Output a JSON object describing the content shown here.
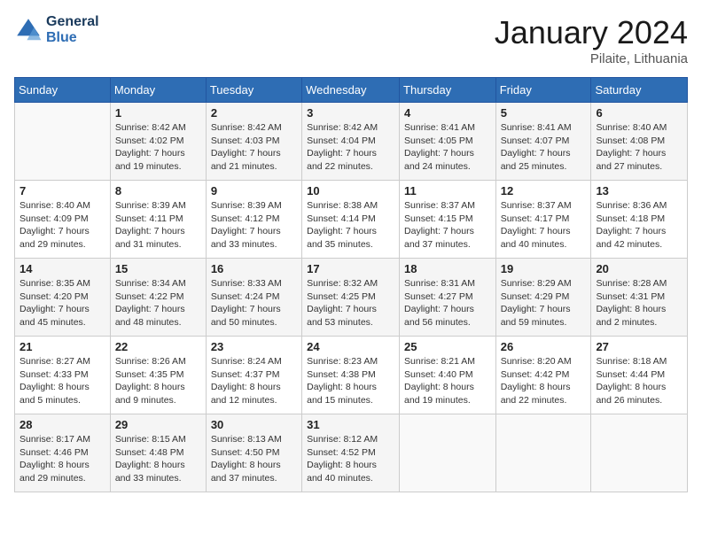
{
  "header": {
    "logo_line1": "General",
    "logo_line2": "Blue",
    "month": "January 2024",
    "location": "Pilaite, Lithuania"
  },
  "weekdays": [
    "Sunday",
    "Monday",
    "Tuesday",
    "Wednesday",
    "Thursday",
    "Friday",
    "Saturday"
  ],
  "weeks": [
    [
      {
        "day": "",
        "sunrise": "",
        "sunset": "",
        "daylight": ""
      },
      {
        "day": "1",
        "sunrise": "8:42 AM",
        "sunset": "4:02 PM",
        "daylight": "7 hours and 19 minutes."
      },
      {
        "day": "2",
        "sunrise": "8:42 AM",
        "sunset": "4:03 PM",
        "daylight": "7 hours and 21 minutes."
      },
      {
        "day": "3",
        "sunrise": "8:42 AM",
        "sunset": "4:04 PM",
        "daylight": "7 hours and 22 minutes."
      },
      {
        "day": "4",
        "sunrise": "8:41 AM",
        "sunset": "4:05 PM",
        "daylight": "7 hours and 24 minutes."
      },
      {
        "day": "5",
        "sunrise": "8:41 AM",
        "sunset": "4:07 PM",
        "daylight": "7 hours and 25 minutes."
      },
      {
        "day": "6",
        "sunrise": "8:40 AM",
        "sunset": "4:08 PM",
        "daylight": "7 hours and 27 minutes."
      }
    ],
    [
      {
        "day": "7",
        "sunrise": "8:40 AM",
        "sunset": "4:09 PM",
        "daylight": "7 hours and 29 minutes."
      },
      {
        "day": "8",
        "sunrise": "8:39 AM",
        "sunset": "4:11 PM",
        "daylight": "7 hours and 31 minutes."
      },
      {
        "day": "9",
        "sunrise": "8:39 AM",
        "sunset": "4:12 PM",
        "daylight": "7 hours and 33 minutes."
      },
      {
        "day": "10",
        "sunrise": "8:38 AM",
        "sunset": "4:14 PM",
        "daylight": "7 hours and 35 minutes."
      },
      {
        "day": "11",
        "sunrise": "8:37 AM",
        "sunset": "4:15 PM",
        "daylight": "7 hours and 37 minutes."
      },
      {
        "day": "12",
        "sunrise": "8:37 AM",
        "sunset": "4:17 PM",
        "daylight": "7 hours and 40 minutes."
      },
      {
        "day": "13",
        "sunrise": "8:36 AM",
        "sunset": "4:18 PM",
        "daylight": "7 hours and 42 minutes."
      }
    ],
    [
      {
        "day": "14",
        "sunrise": "8:35 AM",
        "sunset": "4:20 PM",
        "daylight": "7 hours and 45 minutes."
      },
      {
        "day": "15",
        "sunrise": "8:34 AM",
        "sunset": "4:22 PM",
        "daylight": "7 hours and 48 minutes."
      },
      {
        "day": "16",
        "sunrise": "8:33 AM",
        "sunset": "4:24 PM",
        "daylight": "7 hours and 50 minutes."
      },
      {
        "day": "17",
        "sunrise": "8:32 AM",
        "sunset": "4:25 PM",
        "daylight": "7 hours and 53 minutes."
      },
      {
        "day": "18",
        "sunrise": "8:31 AM",
        "sunset": "4:27 PM",
        "daylight": "7 hours and 56 minutes."
      },
      {
        "day": "19",
        "sunrise": "8:29 AM",
        "sunset": "4:29 PM",
        "daylight": "7 hours and 59 minutes."
      },
      {
        "day": "20",
        "sunrise": "8:28 AM",
        "sunset": "4:31 PM",
        "daylight": "8 hours and 2 minutes."
      }
    ],
    [
      {
        "day": "21",
        "sunrise": "8:27 AM",
        "sunset": "4:33 PM",
        "daylight": "8 hours and 5 minutes."
      },
      {
        "day": "22",
        "sunrise": "8:26 AM",
        "sunset": "4:35 PM",
        "daylight": "8 hours and 9 minutes."
      },
      {
        "day": "23",
        "sunrise": "8:24 AM",
        "sunset": "4:37 PM",
        "daylight": "8 hours and 12 minutes."
      },
      {
        "day": "24",
        "sunrise": "8:23 AM",
        "sunset": "4:38 PM",
        "daylight": "8 hours and 15 minutes."
      },
      {
        "day": "25",
        "sunrise": "8:21 AM",
        "sunset": "4:40 PM",
        "daylight": "8 hours and 19 minutes."
      },
      {
        "day": "26",
        "sunrise": "8:20 AM",
        "sunset": "4:42 PM",
        "daylight": "8 hours and 22 minutes."
      },
      {
        "day": "27",
        "sunrise": "8:18 AM",
        "sunset": "4:44 PM",
        "daylight": "8 hours and 26 minutes."
      }
    ],
    [
      {
        "day": "28",
        "sunrise": "8:17 AM",
        "sunset": "4:46 PM",
        "daylight": "8 hours and 29 minutes."
      },
      {
        "day": "29",
        "sunrise": "8:15 AM",
        "sunset": "4:48 PM",
        "daylight": "8 hours and 33 minutes."
      },
      {
        "day": "30",
        "sunrise": "8:13 AM",
        "sunset": "4:50 PM",
        "daylight": "8 hours and 37 minutes."
      },
      {
        "day": "31",
        "sunrise": "8:12 AM",
        "sunset": "4:52 PM",
        "daylight": "8 hours and 40 minutes."
      },
      {
        "day": "",
        "sunrise": "",
        "sunset": "",
        "daylight": ""
      },
      {
        "day": "",
        "sunrise": "",
        "sunset": "",
        "daylight": ""
      },
      {
        "day": "",
        "sunrise": "",
        "sunset": "",
        "daylight": ""
      }
    ]
  ],
  "labels": {
    "sunrise_prefix": "Sunrise: ",
    "sunset_prefix": "Sunset: ",
    "daylight_prefix": "Daylight: "
  }
}
